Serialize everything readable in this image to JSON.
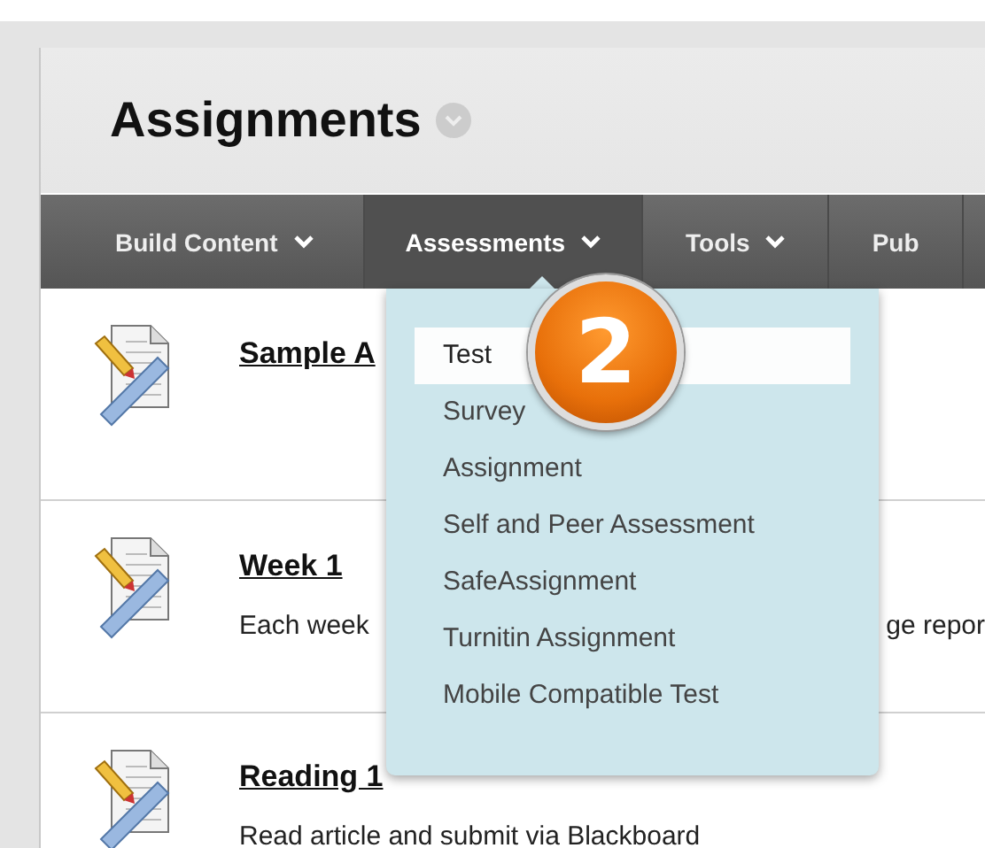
{
  "page": {
    "title": "Assignments"
  },
  "nav": [
    {
      "label": "Build Content",
      "caret": true,
      "selected": false
    },
    {
      "label": "Assessments",
      "caret": true,
      "selected": true
    },
    {
      "label": "Tools",
      "caret": true,
      "selected": false
    },
    {
      "label": "Pub",
      "caret": false,
      "selected": false
    }
  ],
  "items": [
    {
      "title": "Sample A"
    },
    {
      "title": "Week 1",
      "description_start": "Each week",
      "description_end": "ge repor"
    },
    {
      "title": "Reading 1",
      "description_start": "Read article and submit via Blackboard"
    }
  ],
  "menu": [
    {
      "label": "Test",
      "selected": true
    },
    {
      "label": "Survey",
      "selected": false
    },
    {
      "label": "Assignment",
      "selected": false
    },
    {
      "label": "Self and Peer Assessment",
      "selected": false
    },
    {
      "label": "SafeAssignment",
      "selected": false
    },
    {
      "label": "Turnitin Assignment",
      "selected": false
    },
    {
      "label": "Mobile Compatible Test",
      "selected": false
    }
  ],
  "badge": {
    "text": "2"
  }
}
